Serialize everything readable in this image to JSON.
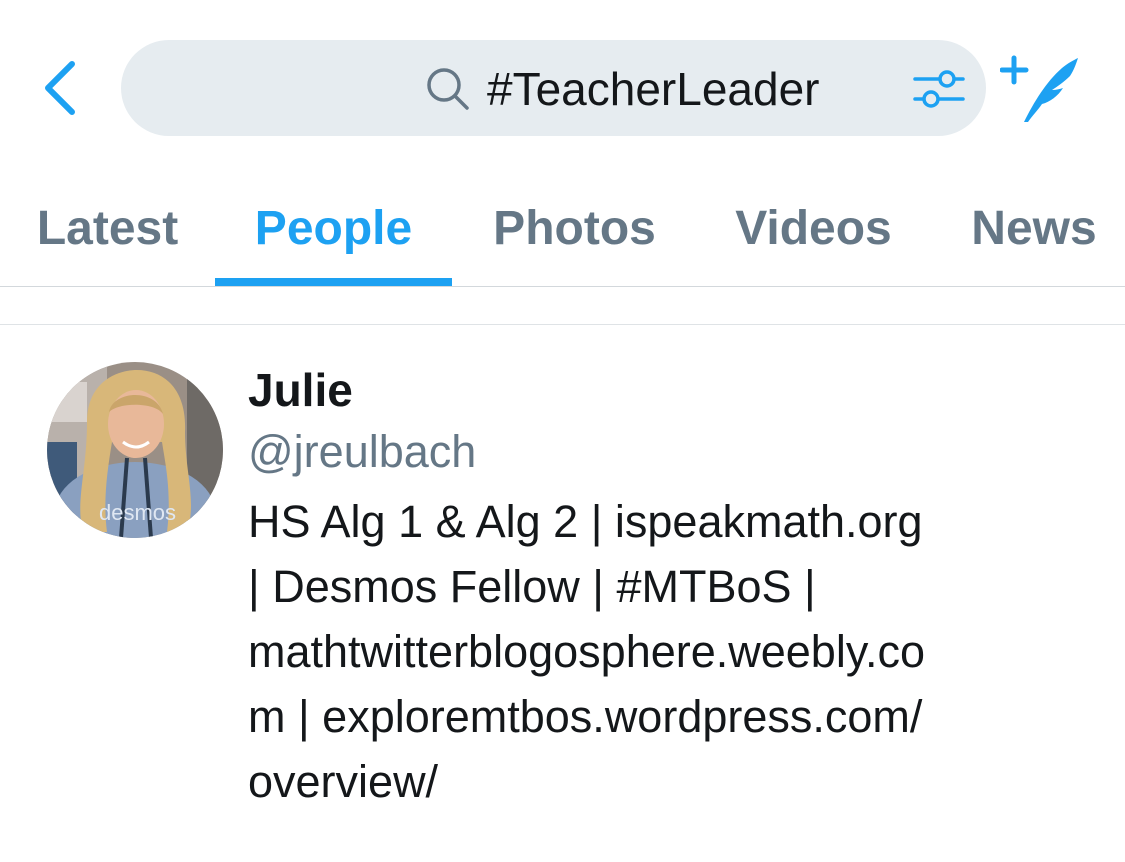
{
  "search": {
    "query": "#TeacherLeader"
  },
  "icons": {
    "back": "chevron-left-icon",
    "search": "search-icon",
    "filter": "sliders-icon",
    "compose": "compose-tweet-icon"
  },
  "tabs": [
    {
      "label": "Latest",
      "active": false
    },
    {
      "label": "People",
      "active": true
    },
    {
      "label": "Photos",
      "active": false
    },
    {
      "label": "Videos",
      "active": false
    },
    {
      "label": "News",
      "active": false
    }
  ],
  "results": [
    {
      "display_name": "Julie",
      "handle": "@jreulbach",
      "bio_lines": [
        "HS Alg 1 & Alg 2 | ispeakmath.org",
        "| Desmos Fellow | #MTBoS |",
        "mathtwitterblogosphere.weebly.co",
        "m | exploremtbos.wordpress.com/",
        "overview/"
      ],
      "avatar_shirt_text": "desmos"
    }
  ],
  "colors": {
    "accent": "#1da1f2",
    "secondary_text": "#657786",
    "primary_text": "#14171a",
    "search_bg": "#e6ecf0"
  }
}
